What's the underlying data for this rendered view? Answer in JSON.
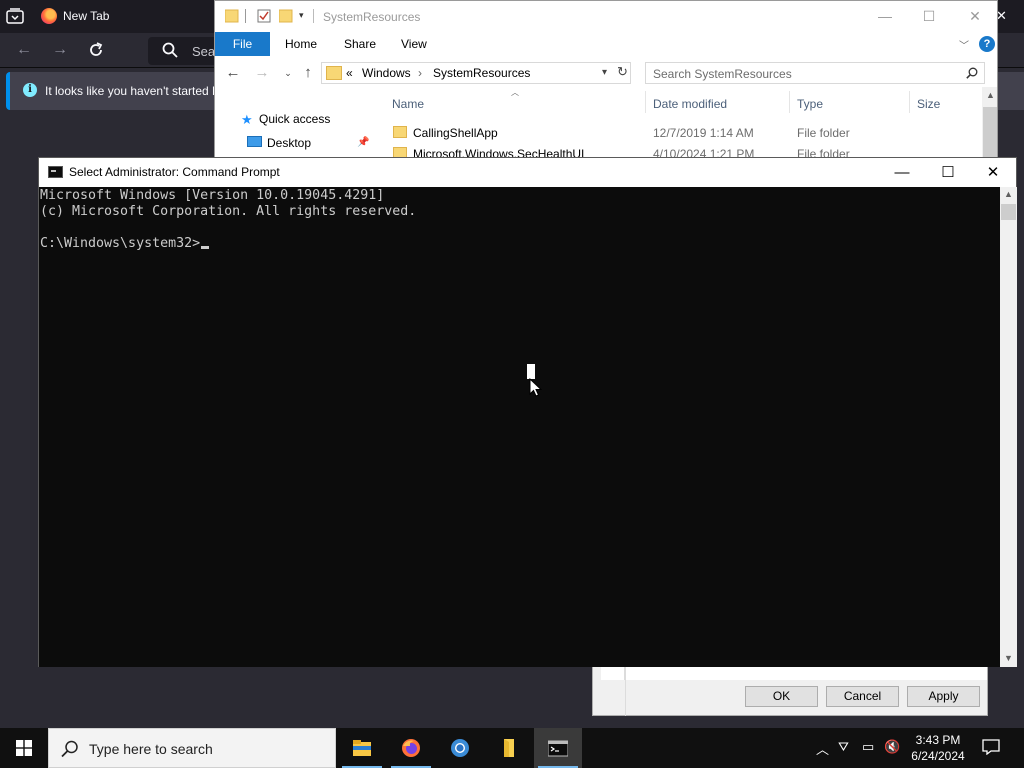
{
  "firefox": {
    "tab_title": "New Tab",
    "search_placeholder": "Sea",
    "notice_text": "It looks like you haven't started F",
    "notice_icon": "info-icon"
  },
  "explorer": {
    "title": "SystemResources",
    "ribbon": {
      "file": "File",
      "home": "Home",
      "share": "Share",
      "view": "View",
      "help": "?"
    },
    "address": {
      "overflow": "«",
      "segments": [
        "Windows",
        "SystemResources"
      ]
    },
    "search_placeholder": "Search SystemResources",
    "nav": {
      "quick_access": "Quick access",
      "desktop": "Desktop"
    },
    "columns": {
      "name": "Name",
      "date": "Date modified",
      "type": "Type",
      "size": "Size"
    },
    "rows": [
      {
        "name": "CallingShellApp",
        "date": "12/7/2019 1:14 AM",
        "type": "File folder"
      },
      {
        "name": "Microsoft.Windows.SecHealthUI",
        "date": "4/10/2024 1:21 PM",
        "type": "File folder"
      }
    ]
  },
  "dialog": {
    "ok": "OK",
    "cancel": "Cancel",
    "apply": "Apply"
  },
  "cmd": {
    "title": "Select Administrator: Command Prompt",
    "lines": [
      "Microsoft Windows [Version 10.0.19045.4291]",
      "(c) Microsoft Corporation. All rights reserved.",
      "",
      "C:\\Windows\\system32>"
    ]
  },
  "taskbar": {
    "search_placeholder": "Type here to search",
    "apps": [
      "file-explorer",
      "firefox",
      "chrome",
      "sticky-folder",
      "command-prompt"
    ],
    "active_app": "command-prompt",
    "time": "3:43 PM",
    "date": "6/24/2024"
  },
  "colors": {
    "accent": "#1979ca",
    "cmd_bg": "#0c0c0c",
    "cmd_text": "#cccccc",
    "firefox_bg": "#2b2a33"
  }
}
